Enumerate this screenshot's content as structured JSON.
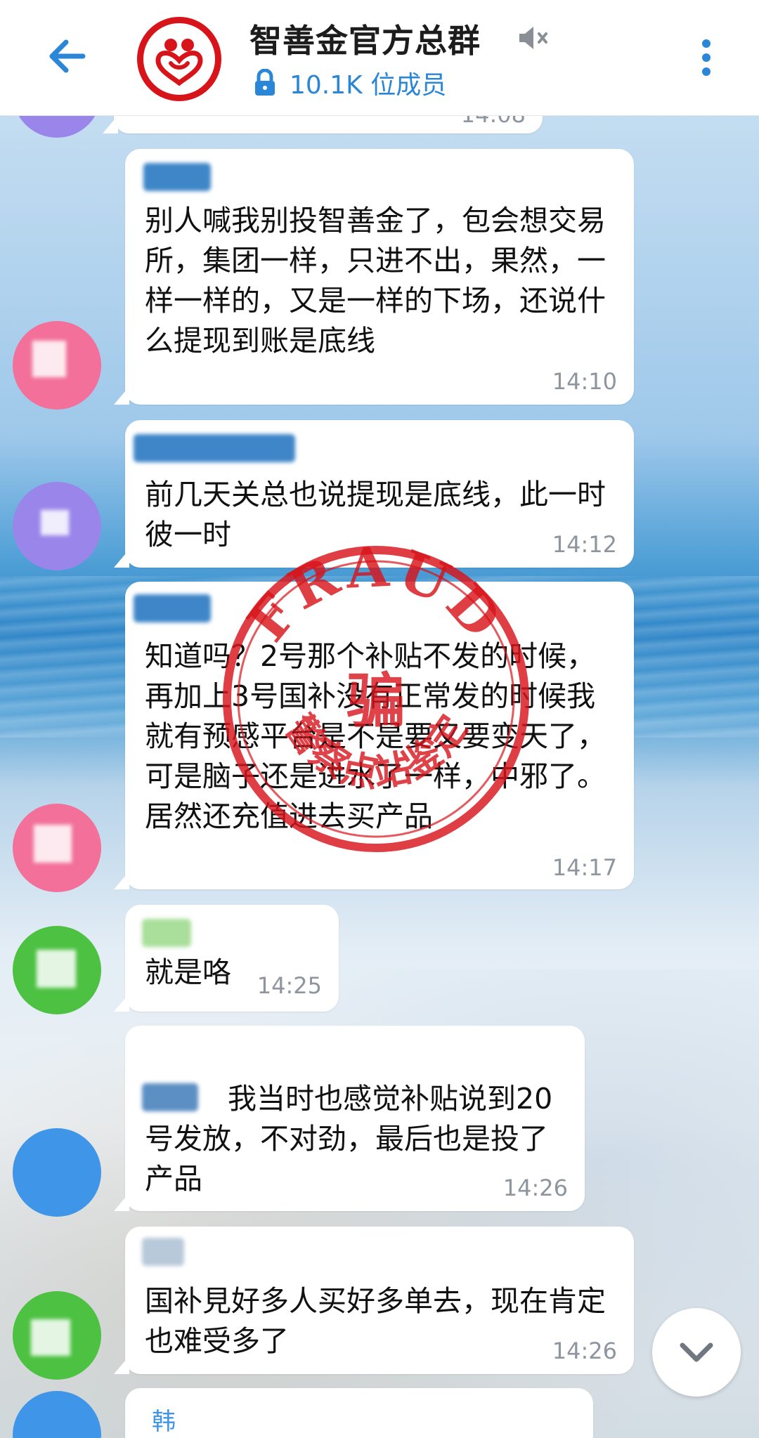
{
  "header": {
    "title": "智善金官方总群",
    "member_count": "10.1K 位成员",
    "back_icon": "arrow-left-icon",
    "mute_icon": "muted-speaker-icon",
    "lock_icon": "lock-icon",
    "more_icon": "more-vertical-icon"
  },
  "colors": {
    "accent": "#2a86d6",
    "stamp_red": "#d8141b",
    "bubble": "#ffffff"
  },
  "messages": [
    {
      "time": "14:08"
    },
    {
      "sender": "",
      "text": "别人喊我别投智善金了，包会想交易所，集团一样，只进不出，果然，一样一样的，又是一样的下场，还说什么提现到账是底线",
      "time": "14:10"
    },
    {
      "sender": "",
      "text": "前几天关总也说提现是底线，此一时彼一时",
      "time": "14:12"
    },
    {
      "sender": "",
      "text": "知道吗？2号那个补贴不发的时候，再加上3号国补没有正常发的时候我就有预感平台是不是要又要变天了，可是脑子还是进水了一样，中邪了。居然还充值进去买产品",
      "time": "14:17"
    },
    {
      "sender": "",
      "text": "就是咯",
      "time": "14:25"
    },
    {
      "sender": "",
      "text": "我当时也感觉补贴说到20号发放，不对劲，最后也是投了产品",
      "time": "14:26"
    },
    {
      "sender": "",
      "text": "国补見好多人买好多单去，现在肯定也难受多了",
      "time": "14:26"
    },
    {
      "sender": "韩"
    }
  ],
  "stamp": {
    "top_text": "FRAUD",
    "center_text": "骗",
    "bottom_text": "警察点站鉴定"
  },
  "scroll_icon": "chevron-down-icon"
}
